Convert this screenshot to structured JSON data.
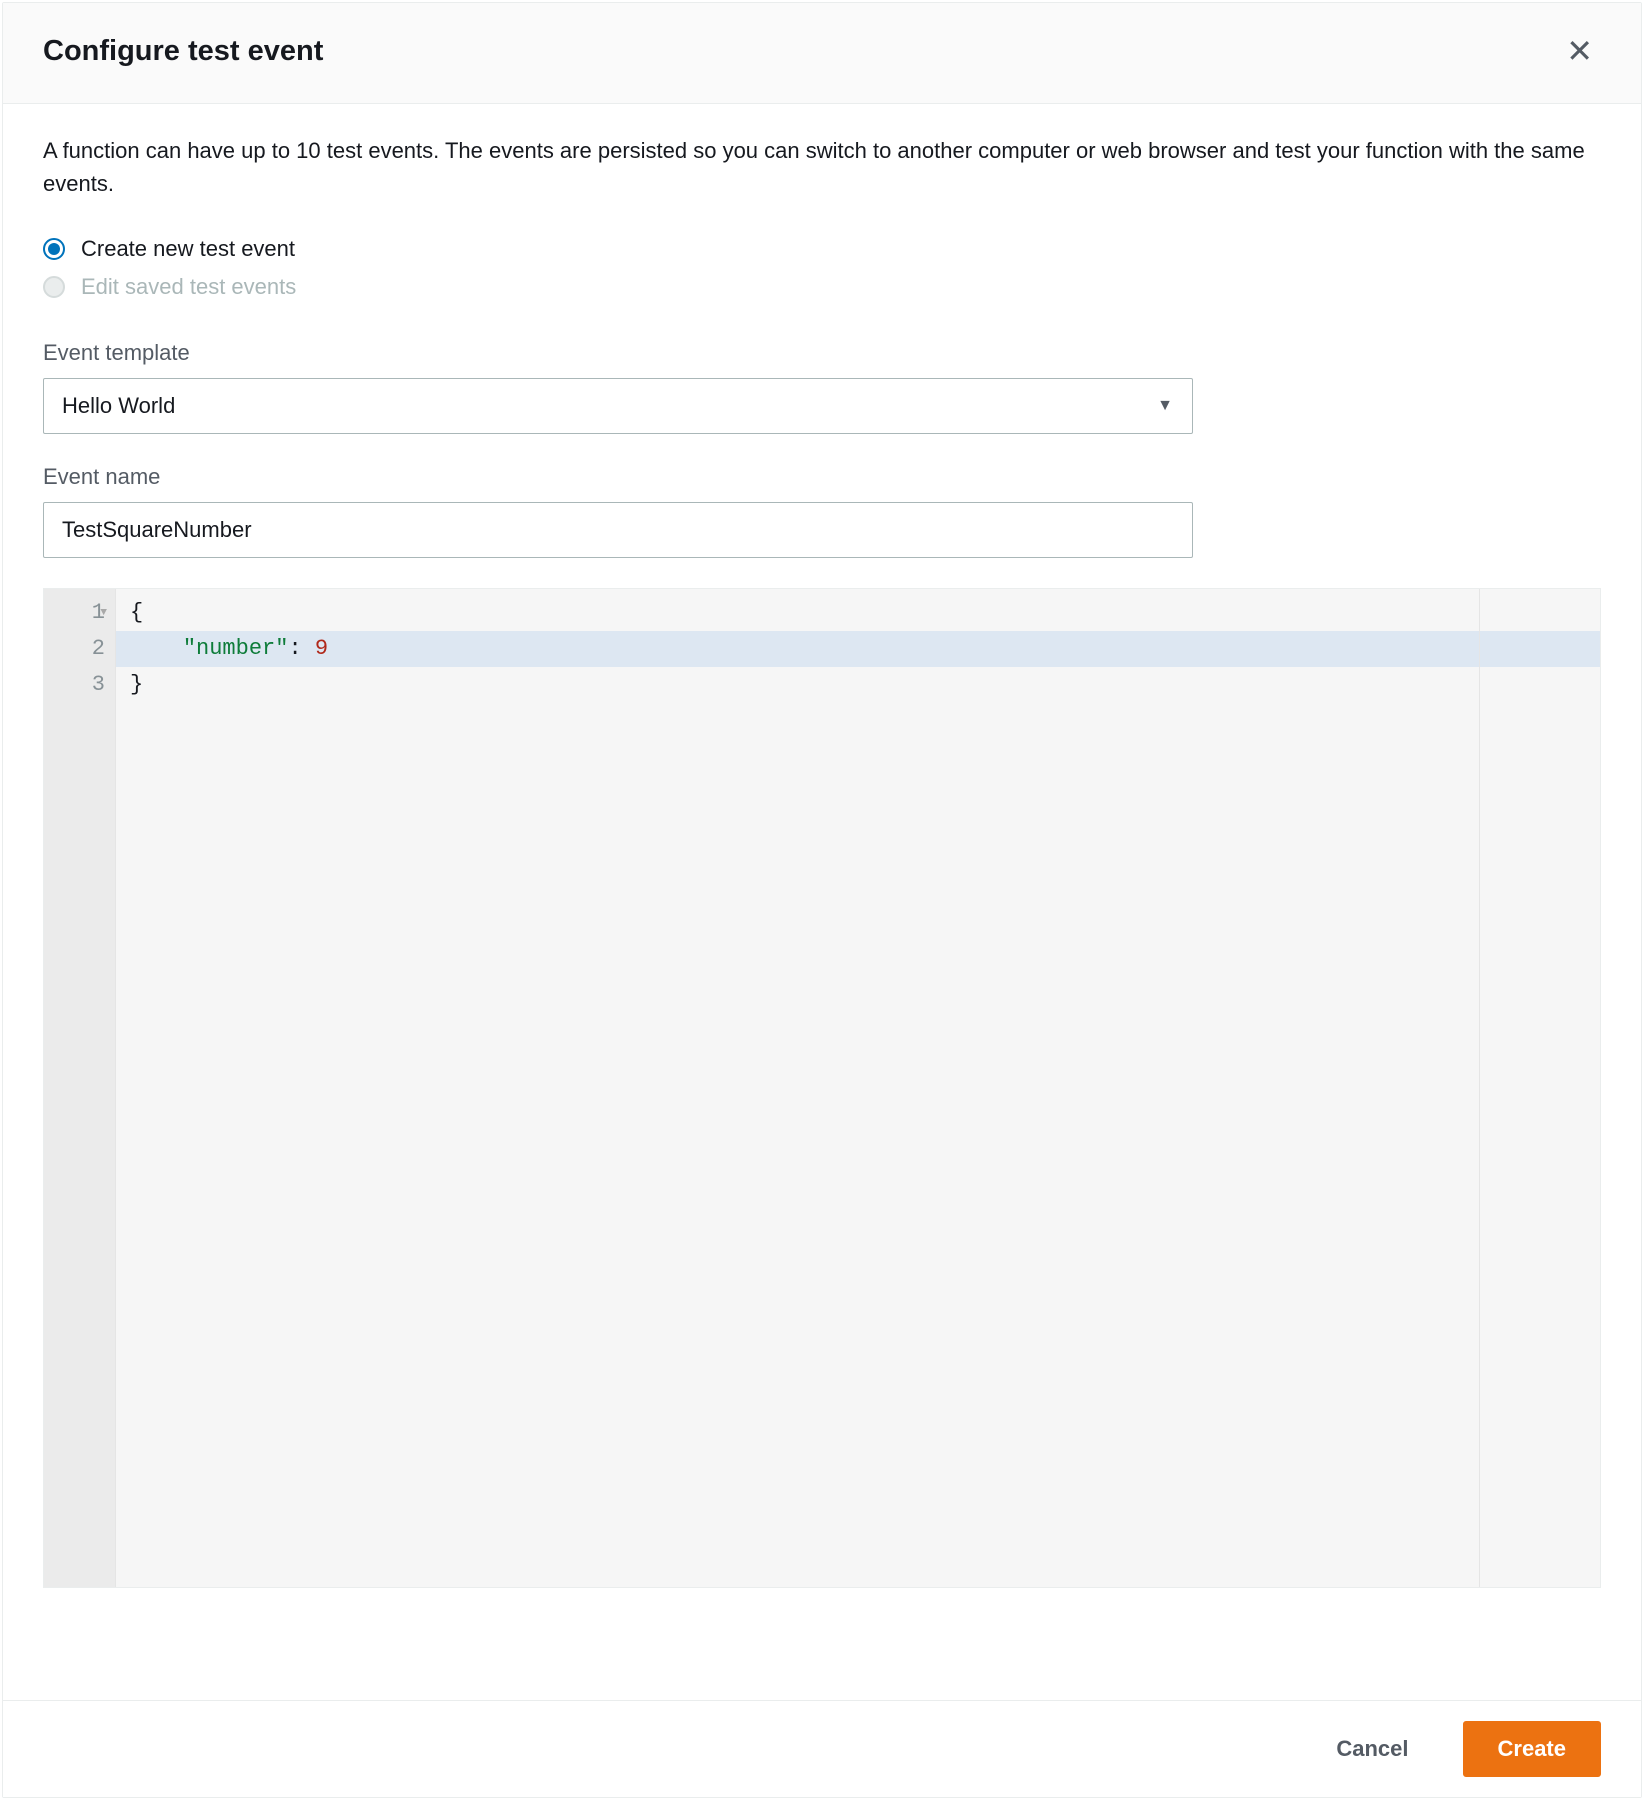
{
  "header": {
    "title": "Configure test event"
  },
  "description": "A function can have up to 10 test events. The events are persisted so you can switch to another computer or web browser and test your function with the same events.",
  "radios": {
    "create": {
      "label": "Create new test event",
      "selected": true
    },
    "edit": {
      "label": "Edit saved test events",
      "disabled": true
    }
  },
  "template": {
    "label": "Event template",
    "value": "Hello World"
  },
  "eventName": {
    "label": "Event name",
    "value": "TestSquareNumber"
  },
  "code": {
    "lines": [
      "1",
      "2",
      "3"
    ],
    "l1_brace_open": "{",
    "l2_indent": "    ",
    "l2_key": "\"number\"",
    "l2_colon": ": ",
    "l2_val": "9",
    "l3_brace_close": "}"
  },
  "footer": {
    "cancel": "Cancel",
    "create": "Create"
  }
}
